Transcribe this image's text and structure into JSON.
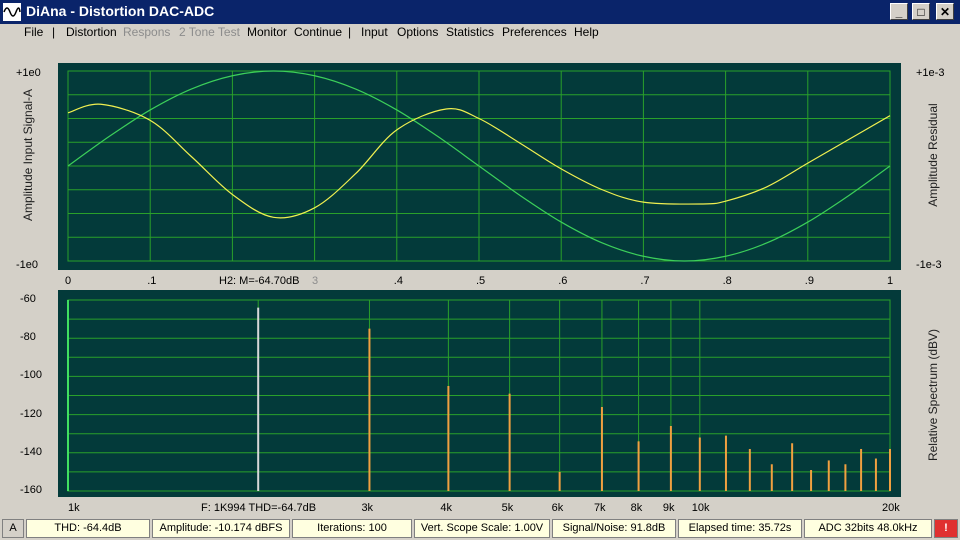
{
  "window": {
    "title": "DiAna - Distortion DAC-ADC",
    "minimize": "_",
    "maximize": "□",
    "close": "✕"
  },
  "menu": {
    "items": [
      {
        "label": "File",
        "enabled": true
      },
      {
        "label": "Distortion",
        "enabled": true
      },
      {
        "label": "Respons",
        "enabled": false
      },
      {
        "label": "2 Tone Test",
        "enabled": false
      },
      {
        "label": "Monitor",
        "enabled": true
      },
      {
        "label": "Continue",
        "enabled": true
      },
      {
        "label": "Input",
        "enabled": true
      },
      {
        "label": "Options",
        "enabled": true
      },
      {
        "label": "Statistics",
        "enabled": true
      },
      {
        "label": "Preferences",
        "enabled": true
      },
      {
        "label": "Help",
        "enabled": true
      }
    ],
    "separator": "|"
  },
  "scope": {
    "left_axis_label": "Amplitude Input Signal-A",
    "right_axis_label": "Amplitude Residual",
    "left_top": "+1e0",
    "left_bottom": "-1e0",
    "right_top": "+1e-3",
    "right_bottom": "-1e-3",
    "x_ticks": [
      "0",
      ".1",
      ".2",
      ".3",
      ".4",
      ".5",
      ".6",
      ".7",
      ".8",
      ".9",
      "1"
    ],
    "marker_text": "H2: M=-64.70dB",
    "marker_faint": "3",
    "colors": {
      "input": "#3ccf5a",
      "residual": "#f0f050",
      "grid": "#2aa02a",
      "background": "#033a3a"
    }
  },
  "spectrum": {
    "right_axis_label": "Relative Spectrum (dBV)",
    "y_ticks": [
      "-60",
      "-80",
      "-100",
      "-120",
      "-140",
      "-160"
    ],
    "x_ticks": [
      "1k",
      "3k",
      "4k",
      "5k",
      "6k",
      "7k",
      "8k",
      "9k",
      "10k",
      "20k"
    ],
    "marker_text": "F: 1K994 THD=-64.7dB",
    "colors": {
      "bars": "#f0a040",
      "fundamental": "#d8d8d8",
      "dc": "#40e060"
    }
  },
  "chart_data": [
    {
      "type": "line",
      "title": "",
      "xlabel": "",
      "ylabel": "Amplitude Input Signal-A",
      "xlim": [
        0,
        1
      ],
      "ylim": [
        -1,
        1
      ],
      "y2label": "Amplitude Residual",
      "y2lim": [
        -0.001,
        0.001
      ],
      "series": [
        {
          "name": "",
          "axis": "left",
          "x": [
            0,
            0.05,
            0.1,
            0.15,
            0.2,
            0.25,
            0.3,
            0.35,
            0.4,
            0.45,
            0.5,
            0.55,
            0.6,
            0.65,
            0.7,
            0.75,
            0.8,
            0.85,
            0.9,
            0.95,
            1.0
          ],
          "y": [
            0.0,
            0.31,
            0.59,
            0.81,
            0.95,
            1.0,
            0.95,
            0.81,
            0.59,
            0.31,
            0.0,
            -0.31,
            -0.59,
            -0.81,
            -0.95,
            -1.0,
            -0.95,
            -0.81,
            -0.59,
            -0.31,
            0.0
          ]
        },
        {
          "name": "",
          "axis": "right",
          "x": [
            0,
            0.04,
            0.1,
            0.15,
            0.2,
            0.25,
            0.3,
            0.35,
            0.4,
            0.46,
            0.5,
            0.55,
            0.6,
            0.65,
            0.7,
            0.77,
            0.8,
            0.85,
            0.9,
            0.95,
            1.0
          ],
          "y": [
            0.00056,
            0.00065,
            0.00048,
            0.0001,
            -0.0003,
            -0.00054,
            -0.00044,
            -8e-05,
            0.00038,
            0.0006,
            0.0005,
            0.00024,
            -3e-05,
            -0.00025,
            -0.00038,
            -0.0004,
            -0.00037,
            -0.00022,
            3e-05,
            0.00028,
            0.00053
          ]
        }
      ]
    },
    {
      "type": "bar",
      "title": "",
      "xlabel": "",
      "ylabel": "Relative Spectrum (dBV)",
      "xscale": "log",
      "xlim": [
        1000,
        20000
      ],
      "ylim": [
        -160,
        -60
      ],
      "series": [
        {
          "name": "",
          "x": [
            2000,
            3000,
            4000,
            5000,
            6000,
            7000,
            8000,
            9000,
            10000,
            11000,
            12000,
            13000,
            14000,
            15000,
            16000,
            17000,
            18000,
            19000,
            20000
          ],
          "y": [
            -64,
            -75,
            -105,
            -109,
            -150,
            -116,
            -134,
            -126,
            -132,
            -131,
            -138,
            -146,
            -135,
            -149,
            -144,
            -146,
            -138,
            -143,
            -138
          ]
        }
      ]
    }
  ],
  "status": {
    "cells": [
      "A",
      "THD:  -64.4dB",
      "Amplitude: -10.174 dBFS",
      "Iterations: 100",
      "Vert. Scope Scale: 1.00V",
      "Signal/Noise:   91.8dB",
      "Elapsed time: 35.72s",
      "ADC 32bits 48.0kHz",
      "!"
    ]
  }
}
